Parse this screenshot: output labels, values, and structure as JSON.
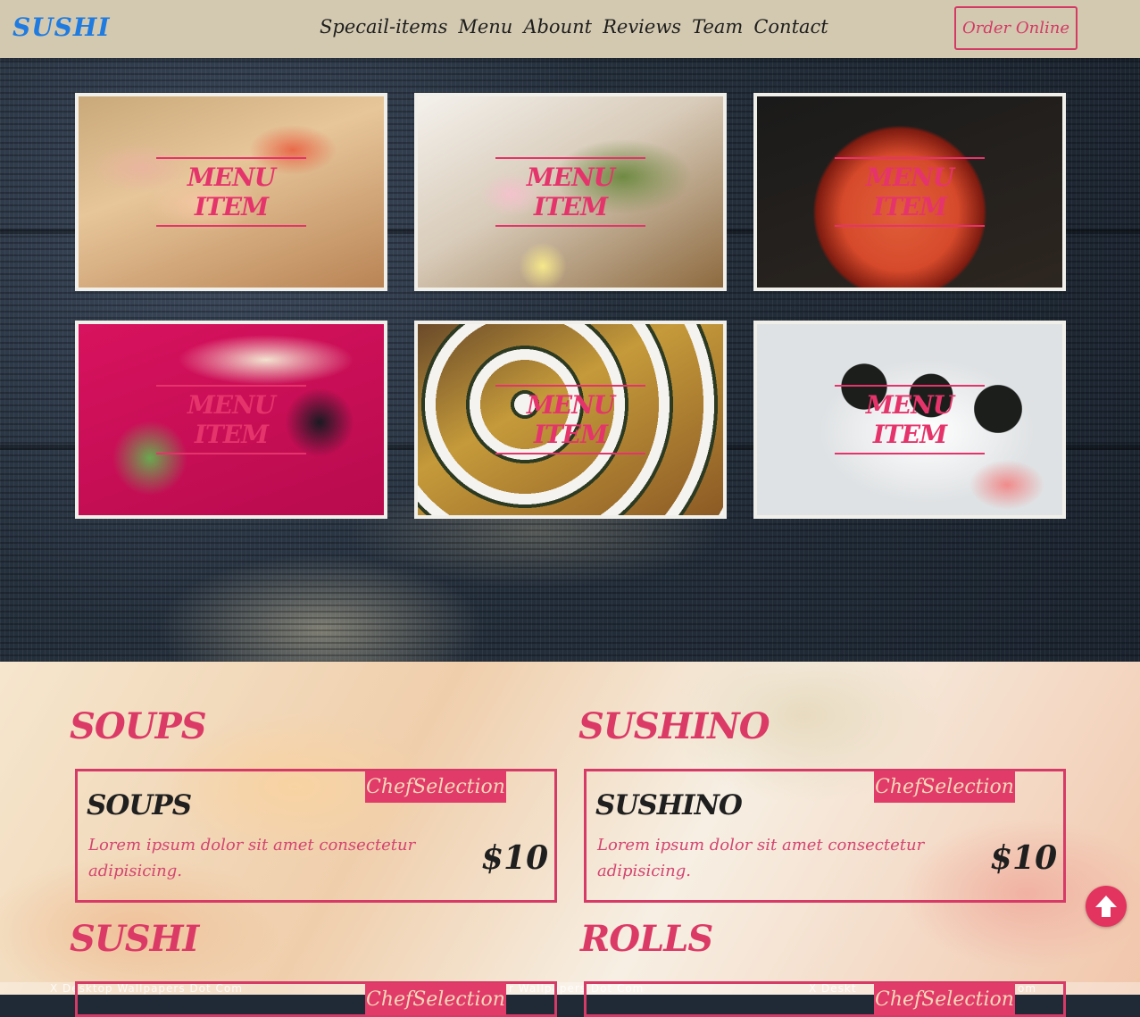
{
  "nav": {
    "logo": "SUSHI",
    "links": [
      "Specail-items",
      "Menu",
      "Abount",
      "Reviews",
      "Team",
      "Contact"
    ],
    "order_button": "Order Online"
  },
  "gallery": {
    "items": [
      {
        "caption": "MENU ITEM"
      },
      {
        "caption": "MENU ITEM"
      },
      {
        "caption": "MENU ITEM"
      },
      {
        "caption": "MENU ITEM"
      },
      {
        "caption": "MENU ITEM"
      },
      {
        "caption": "MENU ITEM"
      }
    ]
  },
  "menu": {
    "categories": [
      {
        "title": "SOUPS",
        "badge": "ChefSelection",
        "item_name": "SOUPS",
        "description": "Lorem ipsum dolor sit amet consectetur adipisicing.",
        "price": "$10"
      },
      {
        "title": "SUSHINO",
        "badge": "ChefSelection",
        "item_name": "SUSHINO",
        "description": "Lorem ipsum dolor sit amet consectetur adipisicing.",
        "price": "$10"
      },
      {
        "title": "SUSHI",
        "badge": "ChefSelection"
      },
      {
        "title": "ROLLS",
        "badge": "ChefSelection"
      }
    ]
  },
  "watermark": [
    "X Desktop Wallpapers Dot Com",
    "r Wallpapers Dot Com",
    "X Deskt",
    "om"
  ],
  "colors": {
    "accent": "#e03b69",
    "nav_bg": "#d3c9b0",
    "logo": "#1f7be0"
  },
  "icons": {
    "scroll_top": "arrow-up-circle-icon"
  }
}
